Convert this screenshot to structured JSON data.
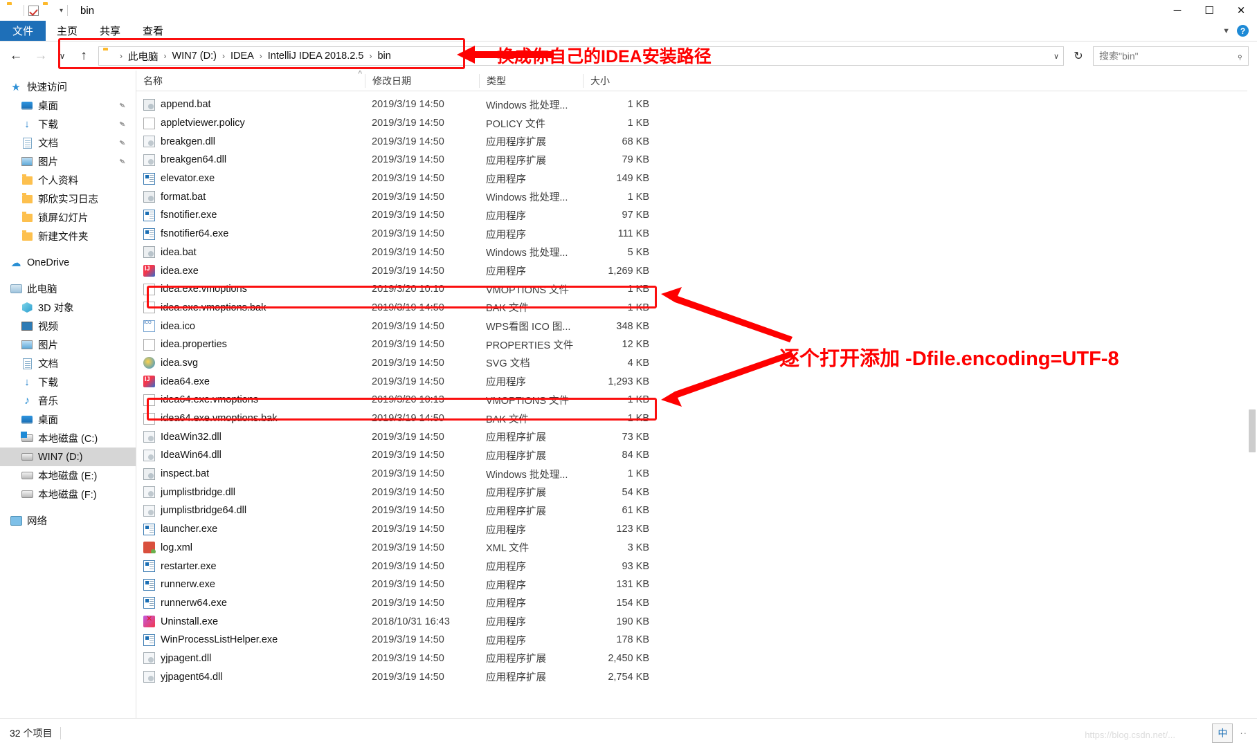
{
  "window": {
    "title": "bin",
    "quick_access_icons": [
      "folder-icon",
      "properties-checkbox-icon",
      "new-folder-icon",
      "customize-caret-icon"
    ],
    "buttons": {
      "minimize": "─",
      "maximize": "☐",
      "close": "✕"
    }
  },
  "ribbon": {
    "tabs": [
      {
        "label": "文件",
        "active": true
      },
      {
        "label": "主页",
        "active": false
      },
      {
        "label": "共享",
        "active": false
      },
      {
        "label": "查看",
        "active": false
      }
    ],
    "collapse_icon": "chevron-down-icon",
    "help_icon": "help-icon",
    "help_glyph": "?"
  },
  "address": {
    "back_glyph": "←",
    "forward_glyph": "→",
    "recent_glyph": "∨",
    "up_glyph": "↑",
    "folder_icon": "folder-icon",
    "breadcrumbs": [
      "此电脑",
      "WIN7 (D:)",
      "IDEA",
      "IntelliJ IDEA 2018.2.5",
      "bin"
    ],
    "separator": "›",
    "dropdown_glyph": "∨",
    "refresh_glyph": "↻"
  },
  "search": {
    "placeholder": "搜索\"bin\"",
    "icon": "search-icon",
    "glyph": "⌕"
  },
  "sidebar": {
    "items": [
      {
        "label": "快速访问",
        "icon": "star-icon",
        "level": 0,
        "pinned": false,
        "selected": false
      },
      {
        "label": "桌面",
        "icon": "desktop-icon",
        "level": 1,
        "pinned": true,
        "selected": false
      },
      {
        "label": "下载",
        "icon": "download-icon",
        "level": 1,
        "pinned": true,
        "selected": false
      },
      {
        "label": "文档",
        "icon": "documents-icon",
        "level": 1,
        "pinned": true,
        "selected": false
      },
      {
        "label": "图片",
        "icon": "pictures-icon",
        "level": 1,
        "pinned": true,
        "selected": false
      },
      {
        "label": "个人资料",
        "icon": "folder-icon",
        "level": 1,
        "pinned": false,
        "selected": false
      },
      {
        "label": "郭欣实习日志",
        "icon": "folder-icon",
        "level": 1,
        "pinned": false,
        "selected": false
      },
      {
        "label": "锁屏幻灯片",
        "icon": "folder-icon",
        "level": 1,
        "pinned": false,
        "selected": false
      },
      {
        "label": "新建文件夹",
        "icon": "folder-icon",
        "level": 1,
        "pinned": false,
        "selected": false
      },
      {
        "label": "OneDrive",
        "icon": "onedrive-icon",
        "level": 0,
        "pinned": false,
        "selected": false,
        "gap_before": true
      },
      {
        "label": "此电脑",
        "icon": "this-pc-icon",
        "level": 0,
        "pinned": false,
        "selected": false,
        "gap_before": true
      },
      {
        "label": "3D 对象",
        "icon": "3d-objects-icon",
        "level": 1,
        "pinned": false,
        "selected": false
      },
      {
        "label": "视频",
        "icon": "videos-icon",
        "level": 1,
        "pinned": false,
        "selected": false
      },
      {
        "label": "图片",
        "icon": "pictures-icon",
        "level": 1,
        "pinned": false,
        "selected": false
      },
      {
        "label": "文档",
        "icon": "documents-icon",
        "level": 1,
        "pinned": false,
        "selected": false
      },
      {
        "label": "下载",
        "icon": "download-icon",
        "level": 1,
        "pinned": false,
        "selected": false
      },
      {
        "label": "音乐",
        "icon": "music-icon",
        "level": 1,
        "pinned": false,
        "selected": false
      },
      {
        "label": "桌面",
        "icon": "desktop-icon",
        "level": 1,
        "pinned": false,
        "selected": false
      },
      {
        "label": "本地磁盘 (C:)",
        "icon": "system-drive-icon",
        "level": 1,
        "pinned": false,
        "selected": false
      },
      {
        "label": "WIN7 (D:)",
        "icon": "drive-icon",
        "level": 1,
        "pinned": false,
        "selected": true
      },
      {
        "label": "本地磁盘 (E:)",
        "icon": "drive-icon",
        "level": 1,
        "pinned": false,
        "selected": false
      },
      {
        "label": "本地磁盘 (F:)",
        "icon": "drive-icon",
        "level": 1,
        "pinned": false,
        "selected": false
      },
      {
        "label": "网络",
        "icon": "network-icon",
        "level": 0,
        "pinned": false,
        "selected": false,
        "gap_before": true
      }
    ],
    "pin_glyph": "✒"
  },
  "filelist": {
    "columns": [
      {
        "key": "name",
        "label": "名称"
      },
      {
        "key": "date",
        "label": "修改日期"
      },
      {
        "key": "type",
        "label": "类型"
      },
      {
        "key": "size",
        "label": "大小"
      }
    ],
    "sort_indicator": "˄",
    "rows": [
      {
        "name": "append.bat",
        "date": "2019/3/19 14:50",
        "type": "Windows 批处理...",
        "size": "1 KB",
        "icon": "bat-file-icon"
      },
      {
        "name": "appletviewer.policy",
        "date": "2019/3/19 14:50",
        "type": "POLICY 文件",
        "size": "1 KB",
        "icon": "blank-file-icon"
      },
      {
        "name": "breakgen.dll",
        "date": "2019/3/19 14:50",
        "type": "应用程序扩展",
        "size": "68 KB",
        "icon": "dll-file-icon"
      },
      {
        "name": "breakgen64.dll",
        "date": "2019/3/19 14:50",
        "type": "应用程序扩展",
        "size": "79 KB",
        "icon": "dll-file-icon"
      },
      {
        "name": "elevator.exe",
        "date": "2019/3/19 14:50",
        "type": "应用程序",
        "size": "149 KB",
        "icon": "exe-file-icon"
      },
      {
        "name": "format.bat",
        "date": "2019/3/19 14:50",
        "type": "Windows 批处理...",
        "size": "1 KB",
        "icon": "bat-file-icon"
      },
      {
        "name": "fsnotifier.exe",
        "date": "2019/3/19 14:50",
        "type": "应用程序",
        "size": "97 KB",
        "icon": "exe-file-icon"
      },
      {
        "name": "fsnotifier64.exe",
        "date": "2019/3/19 14:50",
        "type": "应用程序",
        "size": "111 KB",
        "icon": "exe-file-icon"
      },
      {
        "name": "idea.bat",
        "date": "2019/3/19 14:50",
        "type": "Windows 批处理...",
        "size": "5 KB",
        "icon": "bat-file-icon"
      },
      {
        "name": "idea.exe",
        "date": "2019/3/19 14:50",
        "type": "应用程序",
        "size": "1,269 KB",
        "icon": "idea-app-icon"
      },
      {
        "name": "idea.exe.vmoptions",
        "date": "2019/3/20 10:10",
        "type": "VMOPTIONS 文件",
        "size": "1 KB",
        "icon": "blank-file-icon",
        "highlight": true
      },
      {
        "name": "idea.exe.vmoptions.bak",
        "date": "2019/3/19 14:50",
        "type": "BAK 文件",
        "size": "1 KB",
        "icon": "blank-file-icon"
      },
      {
        "name": "idea.ico",
        "date": "2019/3/19 14:50",
        "type": "WPS看图 ICO 图...",
        "size": "348 KB",
        "icon": "ico-file-icon"
      },
      {
        "name": "idea.properties",
        "date": "2019/3/19 14:50",
        "type": "PROPERTIES 文件",
        "size": "12 KB",
        "icon": "blank-file-icon"
      },
      {
        "name": "idea.svg",
        "date": "2019/3/19 14:50",
        "type": "SVG 文档",
        "size": "4 KB",
        "icon": "svg-file-icon"
      },
      {
        "name": "idea64.exe",
        "date": "2019/3/19 14:50",
        "type": "应用程序",
        "size": "1,293 KB",
        "icon": "idea-app-icon"
      },
      {
        "name": "idea64.exe.vmoptions",
        "date": "2019/3/20 10:13",
        "type": "VMOPTIONS 文件",
        "size": "1 KB",
        "icon": "blank-file-icon",
        "highlight": true
      },
      {
        "name": "idea64.exe.vmoptions.bak",
        "date": "2019/3/19 14:50",
        "type": "BAK 文件",
        "size": "1 KB",
        "icon": "blank-file-icon"
      },
      {
        "name": "IdeaWin32.dll",
        "date": "2019/3/19 14:50",
        "type": "应用程序扩展",
        "size": "73 KB",
        "icon": "dll-file-icon"
      },
      {
        "name": "IdeaWin64.dll",
        "date": "2019/3/19 14:50",
        "type": "应用程序扩展",
        "size": "84 KB",
        "icon": "dll-file-icon"
      },
      {
        "name": "inspect.bat",
        "date": "2019/3/19 14:50",
        "type": "Windows 批处理...",
        "size": "1 KB",
        "icon": "bat-file-icon"
      },
      {
        "name": "jumplistbridge.dll",
        "date": "2019/3/19 14:50",
        "type": "应用程序扩展",
        "size": "54 KB",
        "icon": "dll-file-icon"
      },
      {
        "name": "jumplistbridge64.dll",
        "date": "2019/3/19 14:50",
        "type": "应用程序扩展",
        "size": "61 KB",
        "icon": "dll-file-icon"
      },
      {
        "name": "launcher.exe",
        "date": "2019/3/19 14:50",
        "type": "应用程序",
        "size": "123 KB",
        "icon": "exe-file-icon"
      },
      {
        "name": "log.xml",
        "date": "2019/3/19 14:50",
        "type": "XML 文件",
        "size": "3 KB",
        "icon": "xml-file-icon"
      },
      {
        "name": "restarter.exe",
        "date": "2019/3/19 14:50",
        "type": "应用程序",
        "size": "93 KB",
        "icon": "exe-file-icon"
      },
      {
        "name": "runnerw.exe",
        "date": "2019/3/19 14:50",
        "type": "应用程序",
        "size": "131 KB",
        "icon": "exe-file-icon"
      },
      {
        "name": "runnerw64.exe",
        "date": "2019/3/19 14:50",
        "type": "应用程序",
        "size": "154 KB",
        "icon": "exe-file-icon"
      },
      {
        "name": "Uninstall.exe",
        "date": "2018/10/31 16:43",
        "type": "应用程序",
        "size": "190 KB",
        "icon": "uninstall-icon"
      },
      {
        "name": "WinProcessListHelper.exe",
        "date": "2019/3/19 14:50",
        "type": "应用程序",
        "size": "178 KB",
        "icon": "exe-file-icon"
      },
      {
        "name": "yjpagent.dll",
        "date": "2019/3/19 14:50",
        "type": "应用程序扩展",
        "size": "2,450 KB",
        "icon": "dll-file-icon"
      },
      {
        "name": "yjpagent64.dll",
        "date": "2019/3/19 14:50",
        "type": "应用程序扩展",
        "size": "2,754 KB",
        "icon": "dll-file-icon"
      }
    ]
  },
  "statusbar": {
    "item_count": "32 个项目",
    "ime_label": "中",
    "ime_dots": "··",
    "watermark": "https://blog.csdn.net/..."
  },
  "annotations": {
    "accent_color": "#fe0000",
    "path_note": "换成你自己的IDEA安装路径",
    "vmoptions_note": "逐个打开添加  -Dfile.encoding=UTF-8"
  }
}
